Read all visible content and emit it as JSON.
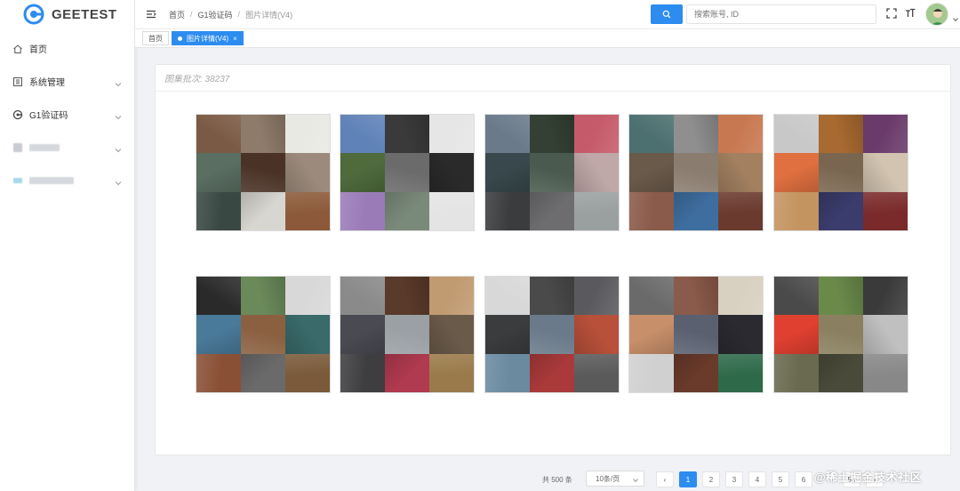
{
  "logo": {
    "text": "GEETEST"
  },
  "sidebar": {
    "items": [
      {
        "label": "首页",
        "icon": "home-icon"
      },
      {
        "label": "系统管理",
        "icon": "system-icon"
      },
      {
        "label": "G1验证码",
        "icon": "captcha-icon"
      }
    ]
  },
  "breadcrumb": {
    "items": [
      "首页",
      "G1验证码",
      "图片详情(V4)"
    ]
  },
  "search": {
    "placeholder": "搜索账号, ID"
  },
  "tabs": [
    {
      "label": "首页"
    },
    {
      "label": "图片详情(V4)"
    }
  ],
  "card": {
    "title": "图集批次: 38237"
  },
  "pagination": {
    "total": "共 500 条",
    "page_size": "10条/页",
    "pages": [
      "1",
      "2",
      "3",
      "4",
      "5",
      "6",
      "50"
    ],
    "prev": "‹",
    "next": "›",
    "active_page": "1"
  },
  "watermark": "@稀土掘金技术社区",
  "colors": {
    "primary": "#2d8cf0",
    "sidebar_bg": "#ffffff",
    "page_bg": "#f0f2f5"
  },
  "images": [
    {
      "palette": [
        "#7a5a44",
        "#8f7b6a",
        "#e9e9e4",
        "#5a6e62",
        "#4a3226",
        "#9c8b7c",
        "#3a4844",
        "#d8d6d0",
        "#8c5a3a"
      ]
    },
    {
      "palette": [
        "#5f82b8",
        "#3a3a3a",
        "#e6e6e6",
        "#4f6b3c",
        "#6b6b6b",
        "#2a2a2a",
        "#9a7bb8",
        "#7a8a7a",
        "#e4e4e4"
      ]
    },
    {
      "palette": [
        "#6a7a8a",
        "#344034",
        "#c55a6a",
        "#38484c",
        "#4a5a4e",
        "#c0a8a8",
        "#3a3c3e",
        "#6d6d70",
        "#9aa0a0"
      ]
    },
    {
      "palette": [
        "#4c6f6f",
        "#8f8f90",
        "#c87850",
        "#6a5a4a",
        "#8a7c6f",
        "#a28060",
        "#8a5a4a",
        "#3e6ea0",
        "#6a3a2e"
      ]
    },
    {
      "palette": [
        "#c8c8c8",
        "#a86a30",
        "#6a3a6a",
        "#e07040",
        "#7a6650",
        "#d2c4b0",
        "#c49460",
        "#3a3c6c",
        "#7a2a2a"
      ]
    },
    {
      "palette": [
        "#2a2a2a",
        "#6a8a5a",
        "#d8d8d8",
        "#4a7a9a",
        "#8a6040",
        "#3a6a6a",
        "#8a5036",
        "#6a6a6a",
        "#7a5a3a"
      ]
    },
    {
      "palette": [
        "#8a8a8a",
        "#5a3a2a",
        "#c09a70",
        "#4a4a52",
        "#9aa0a4",
        "#6a5a4a",
        "#3e3e40",
        "#b03a50",
        "#9a7a4a"
      ]
    },
    {
      "palette": [
        "#d8d8d8",
        "#4a4a4a",
        "#5a5a5e",
        "#3a3c3e",
        "#6a7a8a",
        "#b8503a",
        "#6a8aa0",
        "#aa3a3a",
        "#5a5a5a"
      ]
    },
    {
      "palette": [
        "#6a6a6a",
        "#8a5a4a",
        "#d8d0c0",
        "#c8906a",
        "#5a6070",
        "#2a2a30",
        "#d0d0d0",
        "#6a3a2a",
        "#2e6a4a"
      ]
    },
    {
      "palette": [
        "#4a4a4a",
        "#6a8a4a",
        "#3a3a3a",
        "#e04030",
        "#8a8060",
        "#c0c0c0",
        "#6a6a50",
        "#4a4a3a",
        "#888888"
      ]
    }
  ]
}
